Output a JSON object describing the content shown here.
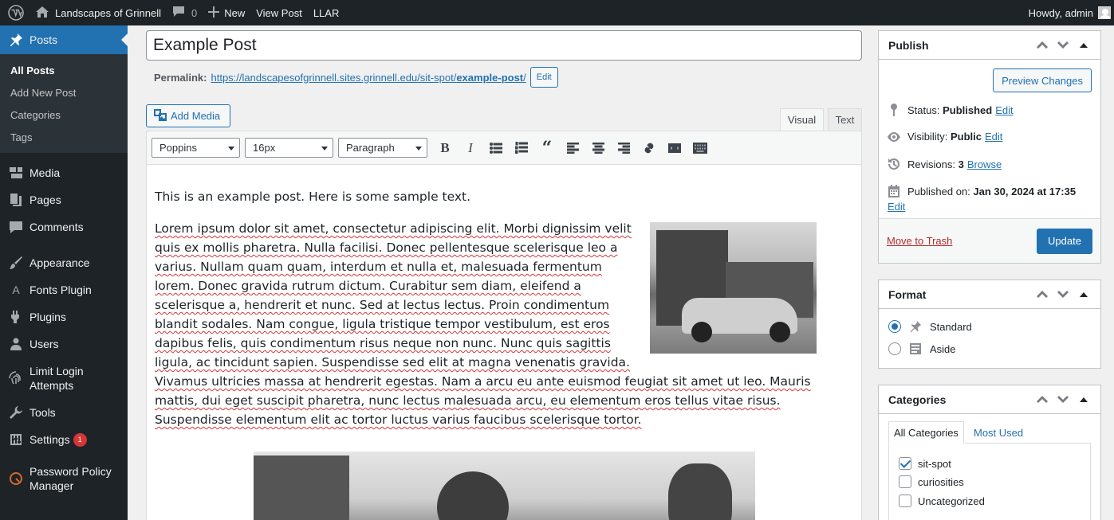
{
  "adminbar": {
    "site_name": "Landscapes of Grinnell",
    "comments_count": "0",
    "new_label": "New",
    "view_post_label": "View Post",
    "llar_label": "LLAR",
    "howdy": "Howdy, admin"
  },
  "menu": {
    "posts": "Posts",
    "posts_sub": [
      "All Posts",
      "Add New Post",
      "Categories",
      "Tags"
    ],
    "media": "Media",
    "pages": "Pages",
    "comments": "Comments",
    "appearance": "Appearance",
    "fonts_plugin": "Fonts Plugin",
    "plugins": "Plugins",
    "users": "Users",
    "limit_login_1": "Limit Login",
    "limit_login_2": "Attempts",
    "tools": "Tools",
    "settings": "Settings",
    "settings_badge": "1",
    "password_policy_1": "Password Policy",
    "password_policy_2": "Manager"
  },
  "post": {
    "title": "Example Post",
    "permalink_label": "Permalink:",
    "permalink_base": "https://landscapesofgrinnell.sites.grinnell.edu/sit-spot/",
    "permalink_slug": "example-post",
    "permalink_end": "/",
    "edit_label": "Edit"
  },
  "editor": {
    "add_media": "Add Media",
    "tab_visual": "Visual",
    "tab_text": "Text",
    "font_family": "Poppins",
    "font_size": "16px",
    "format": "Paragraph",
    "intro": "This is an example post. Here is some sample text.",
    "lorem": "Lorem ipsum dolor sit amet, consectetur adipiscing elit. Morbi dignissim velit quis ex mollis pharetra. Nulla facilisi. Donec pellentesque scelerisque leo a varius. Nullam quam quam, interdum et nulla et, malesuada fermentum lorem. Donec gravida rutrum dictum. Curabitur sem diam, eleifend a scelerisque a, hendrerit et nunc. Sed at lectus lectus. Proin condimentum blandit sodales. Nam congue, ligula tristique tempor vestibulum, est eros dapibus felis, quis condimentum risus neque non nunc. Nunc quis sagittis ligula, ac tincidunt sapien. Suspendisse sed elit at magna venenatis gravida. Vivamus ultricies massa at hendrerit egestas. Nam a arcu eu ante euismod feugiat sit amet ut leo. Mauris mattis, dui eget suscipit pharetra, nunc lectus malesuada arcu, eu elementum eros tellus vitae risus. Suspendisse elementum elit ac tortor luctus varius faucibus scelerisque tortor."
  },
  "publish": {
    "title": "Publish",
    "preview": "Preview Changes",
    "status_label": "Status:",
    "status_value": "Published",
    "visibility_label": "Visibility:",
    "visibility_value": "Public",
    "revisions_label": "Revisions:",
    "revisions_value": "3",
    "browse": "Browse",
    "published_on_label": "Published on:",
    "published_on_value": "Jan 30, 2024 at 17:35",
    "edit": "Edit",
    "trash": "Move to Trash",
    "update": "Update"
  },
  "format": {
    "title": "Format",
    "options": [
      "Standard",
      "Aside"
    ],
    "selected": "Standard"
  },
  "categories": {
    "title": "Categories",
    "tab_all": "All Categories",
    "tab_used": "Most Used",
    "items": [
      {
        "name": "sit-spot",
        "checked": true
      },
      {
        "name": "curiosities",
        "checked": false
      },
      {
        "name": "Uncategorized",
        "checked": false
      }
    ]
  },
  "colors": {
    "accent": "#2271b1",
    "admin_bg": "#1d2327",
    "danger": "#b32d2e"
  }
}
